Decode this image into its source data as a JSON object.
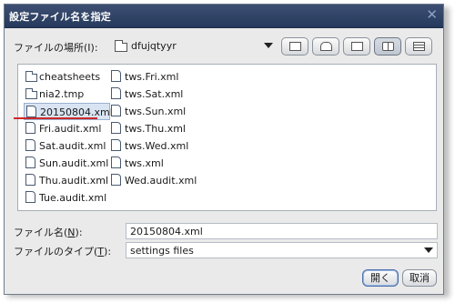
{
  "dialog": {
    "title": "設定ファイル名を指定",
    "close_glyph": "✕"
  },
  "location": {
    "label": "ファイルの場所(I):",
    "value": "dfujqtyyr"
  },
  "toolbar": {
    "buttons": [
      "up-one-level",
      "home",
      "new-folder",
      "list-view",
      "details-view"
    ],
    "active": "list-view"
  },
  "files": {
    "col1": [
      {
        "name": "cheatsheets",
        "type": "folder"
      },
      {
        "name": "nia2.tmp",
        "type": "folder"
      },
      {
        "name": "20150804.xml",
        "type": "file",
        "selected": true
      },
      {
        "name": "Fri.audit.xml",
        "type": "file"
      },
      {
        "name": "Sat.audit.xml",
        "type": "file"
      },
      {
        "name": "Sun.audit.xml",
        "type": "file"
      },
      {
        "name": "Thu.audit.xml",
        "type": "file"
      },
      {
        "name": "Tue.audit.xml",
        "type": "file"
      }
    ],
    "col2": [
      {
        "name": "tws.Fri.xml",
        "type": "file"
      },
      {
        "name": "tws.Sat.xml",
        "type": "file"
      },
      {
        "name": "tws.Sun.xml",
        "type": "file"
      },
      {
        "name": "tws.Thu.xml",
        "type": "file"
      },
      {
        "name": "tws.Wed.xml",
        "type": "file"
      },
      {
        "name": "tws.xml",
        "type": "file"
      },
      {
        "name": "Wed.audit.xml",
        "type": "file"
      }
    ]
  },
  "filename": {
    "label_prefix": "ファイル名(",
    "label_key": "N",
    "label_suffix": "):",
    "value": "20150804.xml"
  },
  "filetype": {
    "label_prefix": "ファイルのタイプ(",
    "label_key": "T",
    "label_suffix": "):",
    "value": "settings files"
  },
  "buttons": {
    "open": "開く",
    "cancel": "取消"
  },
  "colors": {
    "titlebar": "#2f446a",
    "selection": "#d9e4f3",
    "annotation_underline": "#cc2a2a"
  }
}
